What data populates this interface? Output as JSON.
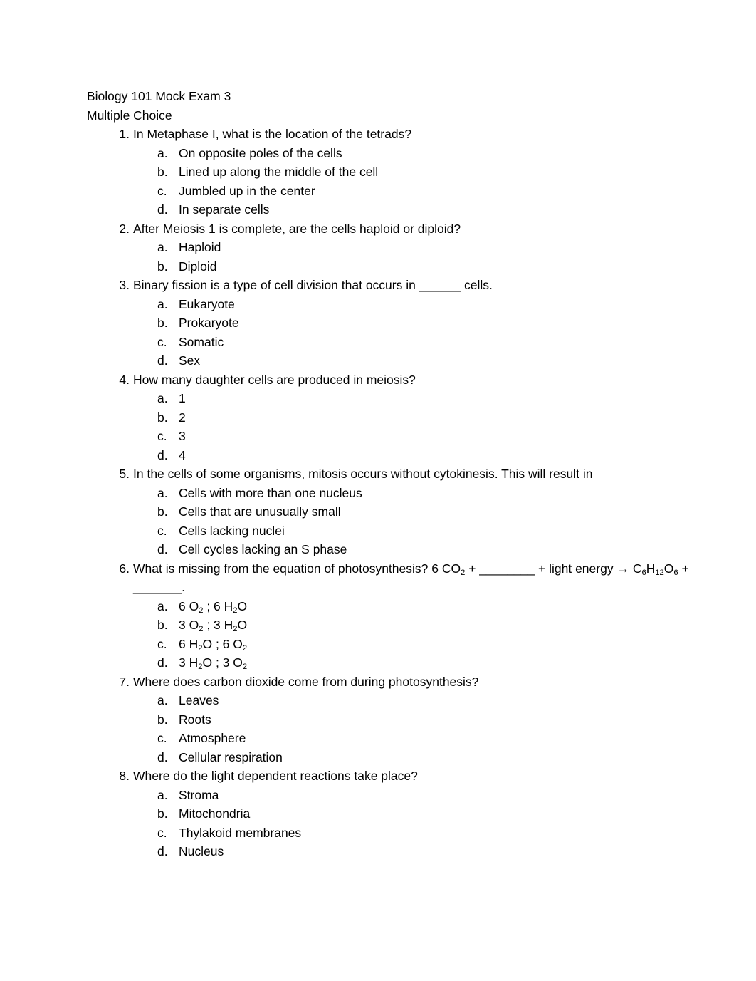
{
  "document": {
    "title": "Biology 101 Mock Exam 3",
    "section_heading": "Multiple Choice"
  },
  "questions": [
    {
      "marker": "1.",
      "text": "In Metaphase I, what is the location of the tetrads?",
      "answers": [
        {
          "marker": "a.",
          "text": "On opposite poles of the cells"
        },
        {
          "marker": "b.",
          "text": "Lined up along the middle of the cell"
        },
        {
          "marker": "c.",
          "text": "Jumbled up in the center"
        },
        {
          "marker": "d.",
          "text": "In separate cells"
        }
      ]
    },
    {
      "marker": "2.",
      "text": "After Meiosis 1 is complete, are the cells haploid or diploid?",
      "answers": [
        {
          "marker": "a.",
          "text": "Haploid"
        },
        {
          "marker": "b.",
          "text": "Diploid"
        }
      ]
    },
    {
      "marker": "3.",
      "text": "Binary fission is a type of cell division that occurs in ______ cells.",
      "answers": [
        {
          "marker": "a.",
          "text": "Eukaryote"
        },
        {
          "marker": "b.",
          "text": "Prokaryote"
        },
        {
          "marker": "c.",
          "text": "Somatic"
        },
        {
          "marker": "d.",
          "text": "Sex"
        }
      ]
    },
    {
      "marker": "4.",
      "text": "How many daughter cells are produced in meiosis?",
      "answers": [
        {
          "marker": "a.",
          "text": "1"
        },
        {
          "marker": "b.",
          "text": "2"
        },
        {
          "marker": "c.",
          "text": "3"
        },
        {
          "marker": "d.",
          "text": "4"
        }
      ]
    },
    {
      "marker": "5.",
      "text": "In the cells of some organisms, mitosis occurs without cytokinesis. This will result in",
      "answers": [
        {
          "marker": "a.",
          "text": "Cells with more than one nucleus"
        },
        {
          "marker": "b.",
          "text": "Cells that are unusually small"
        },
        {
          "marker": "c.",
          "text": "Cells lacking nuclei"
        },
        {
          "marker": "d.",
          "text": "Cell cycles lacking an S phase"
        }
      ]
    },
    {
      "marker": "6.",
      "text": "What is missing from the equation of photosynthesis? 6 CO2 + ________ + light energy → C6H12O6 + _______.",
      "rich": true,
      "answers": [
        {
          "marker": "a.",
          "text": "6 O2 ; 6 H2O",
          "rich": true
        },
        {
          "marker": "b.",
          "text": "3 O2 ; 3 H2O",
          "rich": true
        },
        {
          "marker": "c.",
          "text": "6 H2O ; 6 O2",
          "rich": true
        },
        {
          "marker": "d.",
          "text": "3 H2O ; 3 O2",
          "rich": true
        }
      ]
    },
    {
      "marker": "7.",
      "text": "Where does carbon dioxide come from during photosynthesis?",
      "answers": [
        {
          "marker": "a.",
          "text": "Leaves"
        },
        {
          "marker": "b.",
          "text": "Roots"
        },
        {
          "marker": "c.",
          "text": "Atmosphere"
        },
        {
          "marker": "d.",
          "text": "Cellular respiration"
        }
      ]
    },
    {
      "marker": "8.",
      "text": "Where do the light dependent reactions take place?",
      "answers": [
        {
          "marker": "a.",
          "text": "Stroma"
        },
        {
          "marker": "b.",
          "text": "Mitochondria"
        },
        {
          "marker": "c.",
          "text": "Thylakoid membranes"
        },
        {
          "marker": "d.",
          "text": "Nucleus"
        }
      ]
    }
  ],
  "chemistry": {
    "q6_line1_prefix": "What is missing from the equation of photosynthesis? 6 CO",
    "q6_co2_sub": "2",
    "q6_after_co2": " + ",
    "q6_blank1": "________",
    "q6_after_blank1": " + light energy",
    "q6_arrow": "→ C",
    "q6_glucose_sub1": "6",
    "q6_glucose_h": "H",
    "q6_glucose_sub2": "12",
    "q6_glucose_o": "O",
    "q6_glucose_sub3": "6",
    "q6_after_glucose": " + ",
    "q6_blank2": "_______",
    "q6_period": "."
  },
  "blanks": {
    "q3_blank": "______"
  }
}
